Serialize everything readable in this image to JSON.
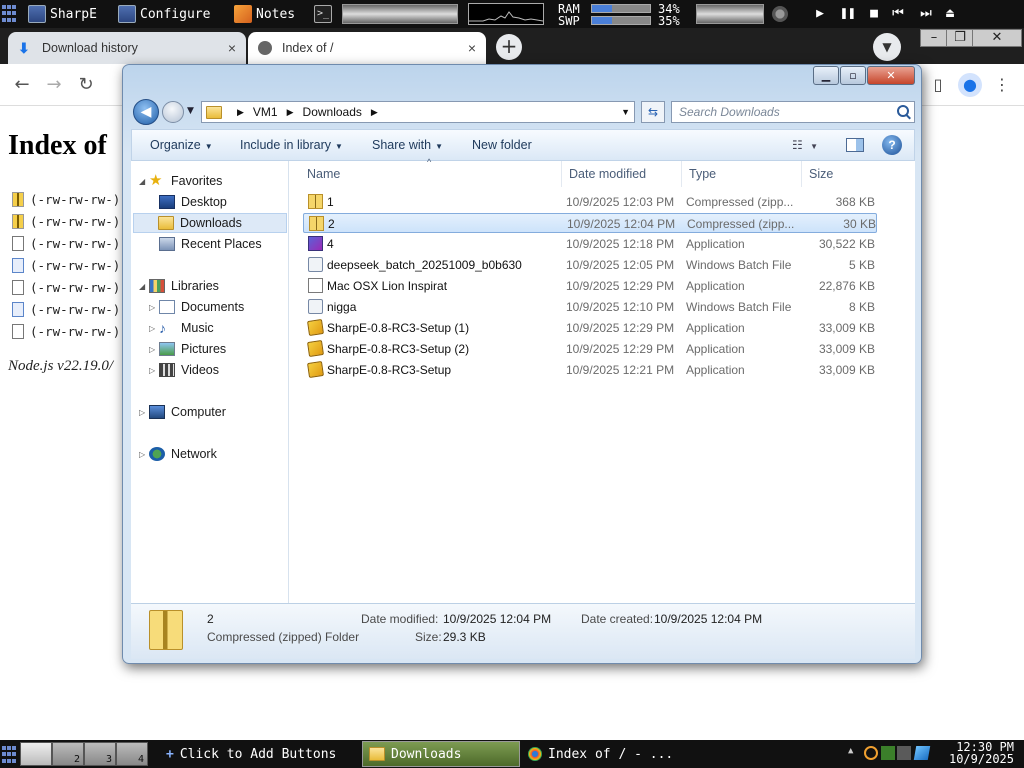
{
  "top_panel": {
    "app1": "SharpE",
    "app2": "Configure",
    "app3": "Notes",
    "term_glyph": ">_",
    "ram_label": "RAM",
    "swp_label": "SWP",
    "ram_pct": "34%",
    "swp_pct": "35%",
    "ram_value": 0.34,
    "swp_value": 0.35
  },
  "browser": {
    "tabs": [
      {
        "title": "Download history",
        "close": "×"
      },
      {
        "title": "Index of /",
        "close": "×"
      }
    ],
    "new_tab": "+",
    "window_controls": [
      "–",
      "❐",
      "✕"
    ]
  },
  "page": {
    "heading": "Index of",
    "perm_rows": [
      "(-rw-rw-rw-)",
      "(-rw-rw-rw-)",
      "(-rw-rw-rw-)",
      "(-rw-rw-rw-)",
      "(-rw-rw-rw-)",
      "(-rw-rw-rw-)",
      "(-rw-rw-rw-)"
    ],
    "footer": "Node.js v22.19.0/"
  },
  "explorer": {
    "breadcrumb": [
      "VM1",
      "Downloads"
    ],
    "search_placeholder": "Search Downloads",
    "commands": [
      "Organize",
      "Include in library",
      "Share with",
      "New folder"
    ],
    "nav": {
      "favorites": "Favorites",
      "desktop": "Desktop",
      "downloads": "Downloads",
      "recent": "Recent Places",
      "libraries": "Libraries",
      "documents": "Documents",
      "music": "Music",
      "pictures": "Pictures",
      "videos": "Videos",
      "computer": "Computer",
      "network": "Network"
    },
    "columns": {
      "name": "Name",
      "date": "Date modified",
      "type": "Type",
      "size": "Size"
    },
    "files": [
      {
        "name": "1",
        "date": "10/9/2025 12:03 PM",
        "type": "Compressed (zipp...",
        "size": "368 KB"
      },
      {
        "name": "2",
        "date": "10/9/2025 12:04 PM",
        "type": "Compressed (zipp...",
        "size": "30 KB"
      },
      {
        "name": "4",
        "date": "10/9/2025 12:18 PM",
        "type": "Application",
        "size": "30,522 KB"
      },
      {
        "name": "deepseek_batch_20251009_b0b630",
        "date": "10/9/2025 12:05 PM",
        "type": "Windows Batch File",
        "size": "5 KB"
      },
      {
        "name": "Mac OSX Lion Inspirat",
        "date": "10/9/2025 12:29 PM",
        "type": "Application",
        "size": "22,876 KB"
      },
      {
        "name": "nigga",
        "date": "10/9/2025 12:10 PM",
        "type": "Windows Batch File",
        "size": "8 KB"
      },
      {
        "name": "SharpE-0.8-RC3-Setup (1)",
        "date": "10/9/2025 12:29 PM",
        "type": "Application",
        "size": "33,009 KB"
      },
      {
        "name": "SharpE-0.8-RC3-Setup (2)",
        "date": "10/9/2025 12:29 PM",
        "type": "Application",
        "size": "33,009 KB"
      },
      {
        "name": "SharpE-0.8-RC3-Setup",
        "date": "10/9/2025 12:21 PM",
        "type": "Application",
        "size": "33,009 KB"
      }
    ],
    "details": {
      "name": "2",
      "kind": "Compressed (zipped) Folder",
      "modified_label": "Date modified:",
      "modified_value": "10/9/2025 12:04 PM",
      "created_label": "Date created:",
      "created_value": "10/9/2025 12:04 PM",
      "size_label": "Size:",
      "size_value": "29.3 KB"
    }
  },
  "bottom_panel": {
    "workspaces": [
      "",
      "2",
      "3",
      "4"
    ],
    "add_buttons": "Click to Add Buttons",
    "task1": "Downloads",
    "task2": "Index of / - ...",
    "time": "12:30 PM",
    "date": "10/9/2025"
  }
}
